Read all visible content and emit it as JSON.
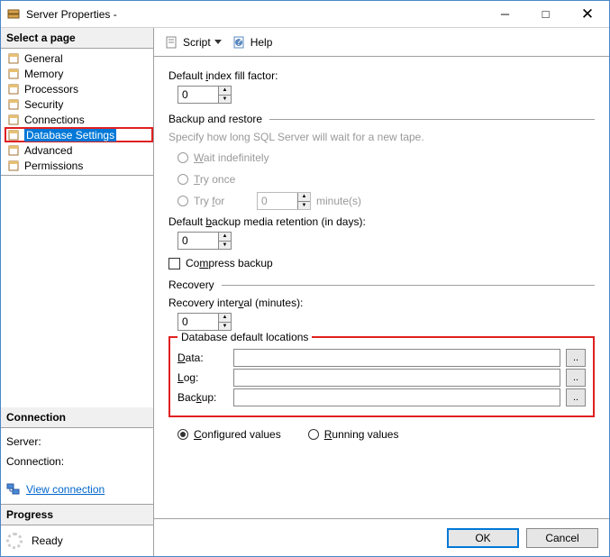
{
  "window": {
    "title": "Server Properties - "
  },
  "sidebar": {
    "select_page": "Select a page",
    "items": [
      {
        "label": "General"
      },
      {
        "label": "Memory"
      },
      {
        "label": "Processors"
      },
      {
        "label": "Security"
      },
      {
        "label": "Connections"
      },
      {
        "label": "Database Settings"
      },
      {
        "label": "Advanced"
      },
      {
        "label": "Permissions"
      }
    ],
    "connection_header": "Connection",
    "server_label": "Server:",
    "connection_label": "Connection:",
    "view_connection": "View connection ",
    "progress_header": "Progress",
    "progress_status": "Ready"
  },
  "toolbar": {
    "script": "Script",
    "help": "Help"
  },
  "content": {
    "fill_factor_label": "Default index fill factor:",
    "fill_factor_value": "0",
    "backup_restore_header": "Backup and restore",
    "backup_hint": "Specify how long SQL Server will wait for a new tape.",
    "wait_indef": "Wait indefinitely",
    "try_once": "Try once",
    "try_for": "Try for",
    "try_for_value": "0",
    "try_for_unit": "minute(s)",
    "retention_label": "Default backup media retention (in days):",
    "retention_value": "0",
    "compress_label": "Compress backup",
    "recovery_header": "Recovery",
    "recovery_interval_label": "Recovery interval (minutes):",
    "recovery_interval_value": "0",
    "locations_header": "Database default locations",
    "data_label": "Data:",
    "log_label": "Log:",
    "backup_label": "Backup:",
    "data_value": "",
    "log_value": "",
    "backup_value": "",
    "configured": "Configured values",
    "running": "Running values"
  },
  "footer": {
    "ok": "OK",
    "cancel": "Cancel"
  }
}
